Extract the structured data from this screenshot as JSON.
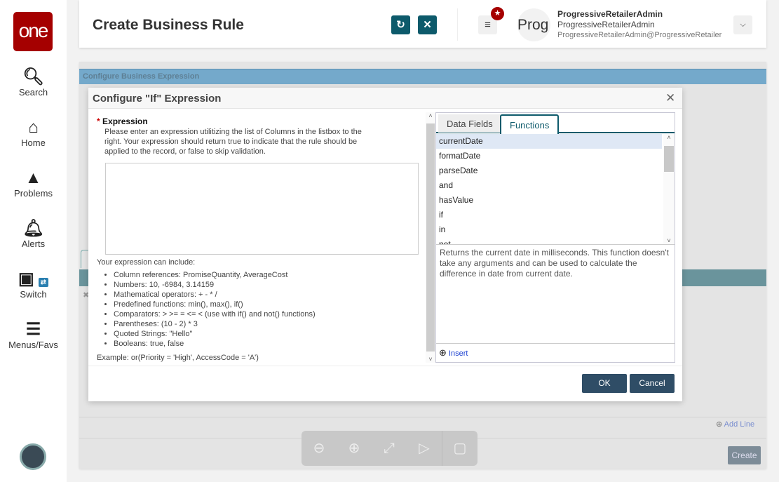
{
  "sidebar": {
    "logo": "one",
    "items": [
      {
        "label": "Search",
        "icon": "search-icon"
      },
      {
        "label": "Home",
        "icon": "home-icon"
      },
      {
        "label": "Problems",
        "icon": "warning-icon"
      },
      {
        "label": "Alerts",
        "icon": "bell-icon"
      },
      {
        "label": "Switch",
        "icon": "switch-icon"
      },
      {
        "label": "Menus/Favs",
        "icon": "menu-icon"
      }
    ]
  },
  "header": {
    "title": "Create Business Rule",
    "avatar_text": "Prog",
    "user_name": "ProgressiveRetailerAdmin",
    "user_role": "ProgressiveRetailerAdmin",
    "user_email": "ProgressiveRetailerAdmin@ProgressiveRetailer"
  },
  "background": {
    "section_title": "Configure Business Expression",
    "add_line": "Add Line",
    "create": "Create"
  },
  "dialog": {
    "title": "Configure \"If\" Expression",
    "required_mark": "*",
    "expression_label": "Expression",
    "expression_help": "Please enter an expression utilitizing the list of Columns in the listbox to the right. Your expression should return true to indicate that the rule should be applied to the record, or false to skip validation.",
    "expression_value": "",
    "include_heading": "Your expression can include:",
    "include_items": [
      "Column references: PromiseQuantity, AverageCost",
      "Numbers: 10, -6984, 3.14159",
      "Mathematical operators: + - * /",
      "Predefined functions: min(), max(), if()",
      "Comparators: > >= = <= < (use with if() and not() functions)",
      "Parentheses: (10 - 2) * 3",
      "Quoted Strings: \"Hello\"",
      "Booleans: true, false"
    ],
    "example": "Example: or(Priority = 'High', AccessCode = 'A')",
    "tabs": [
      {
        "label": "Data Fields",
        "active": false
      },
      {
        "label": "Functions",
        "active": true
      }
    ],
    "functions": [
      "currentDate",
      "formatDate",
      "parseDate",
      "and",
      "hasValue",
      "if",
      "in",
      "not"
    ],
    "selected_function": "currentDate",
    "description": "Returns the current date in milliseconds. This function doesn't take any arguments and can be used to calculate the difference in date from current date.",
    "insert": "Insert",
    "ok": "OK",
    "cancel": "Cancel"
  },
  "colors": {
    "brand": "#a50000",
    "teal": "#0d5a6b",
    "button": "#2f4d66",
    "section_bar": "#74a9cb"
  }
}
